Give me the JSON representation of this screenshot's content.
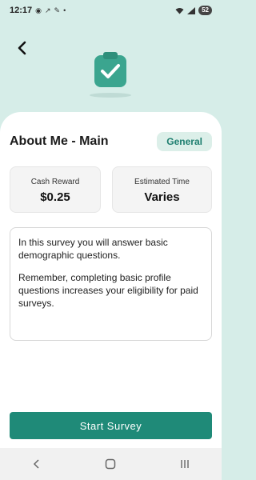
{
  "status_bar": {
    "time": "12:17",
    "battery": "52"
  },
  "header": {
    "back_icon": "chevron-left-icon",
    "hero_icon": "clipboard-check-icon"
  },
  "survey": {
    "title": "About Me - Main",
    "category": "General",
    "cash_reward_label": "Cash Reward",
    "cash_reward_value": "$0.25",
    "estimated_time_label": "Estimated Time",
    "estimated_time_value": "Varies",
    "description_p1": "In this survey you will answer basic demographic questions.",
    "description_p2": "Remember, completing basic profile questions increases your eligibility for paid surveys."
  },
  "actions": {
    "start_label": "Start Survey"
  },
  "colors": {
    "accent": "#1f8a78",
    "header_bg": "#d6ede8",
    "badge_bg": "#dcefe9"
  },
  "nav": {
    "icons": [
      "back-nav-icon",
      "home-nav-icon",
      "recents-nav-icon"
    ]
  }
}
